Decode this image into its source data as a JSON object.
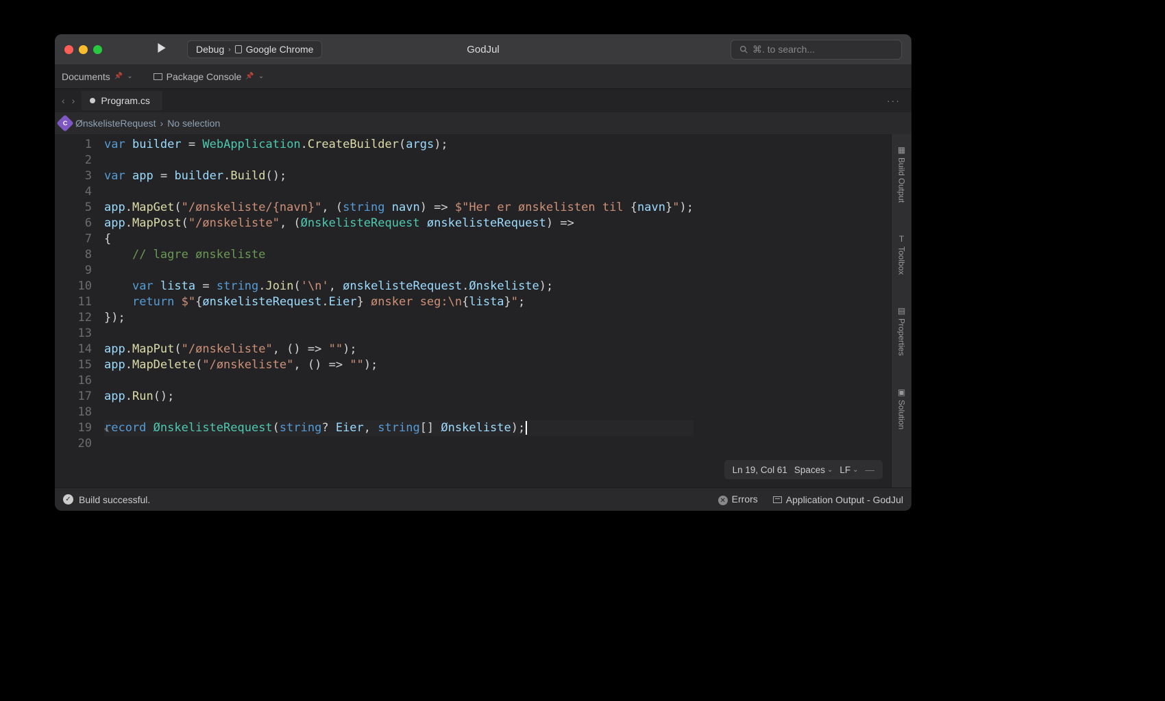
{
  "window": {
    "title": "GodJul"
  },
  "titlebar": {
    "debug_config": "Debug",
    "target": "Google Chrome",
    "search_placeholder": "⌘. to search..."
  },
  "toolrow": {
    "documents": "Documents",
    "package_console": "Package Console"
  },
  "tabs": {
    "active": "Program.cs"
  },
  "breadcrumb": {
    "item1": "ØnskelisteRequest",
    "item2": "No selection"
  },
  "side_panels": [
    "Build Output",
    "Toolbox",
    "Properties",
    "Solution"
  ],
  "cursor_status": {
    "position": "Ln 19, Col 61",
    "indent": "Spaces",
    "eol": "LF"
  },
  "statusbar": {
    "build_msg": "Build successful.",
    "errors_label": "Errors",
    "app_output_label": "Application Output - GodJul"
  },
  "code": {
    "line_count": 20,
    "tokens": [
      [
        [
          "kw",
          "var"
        ],
        [
          "",
          " "
        ],
        [
          "param",
          "builder"
        ],
        [
          "",
          " "
        ],
        [
          "op",
          "="
        ],
        [
          "",
          " "
        ],
        [
          "type",
          "WebApplication"
        ],
        [
          "",
          "."
        ],
        [
          "method",
          "CreateBuilder"
        ],
        [
          "",
          "("
        ],
        [
          "param",
          "args"
        ],
        [
          "",
          ");"
        ]
      ],
      [],
      [
        [
          "kw",
          "var"
        ],
        [
          "",
          " "
        ],
        [
          "param",
          "app"
        ],
        [
          "",
          " "
        ],
        [
          "op",
          "="
        ],
        [
          "",
          " "
        ],
        [
          "param",
          "builder"
        ],
        [
          "",
          "."
        ],
        [
          "method",
          "Build"
        ],
        [
          "",
          "();"
        ]
      ],
      [],
      [
        [
          "param",
          "app"
        ],
        [
          "",
          "."
        ],
        [
          "method",
          "MapGet"
        ],
        [
          "",
          "("
        ],
        [
          "str",
          "\"/ønskeliste/{navn}\""
        ],
        [
          "",
          ", ("
        ],
        [
          "kw",
          "string"
        ],
        [
          "",
          " "
        ],
        [
          "param",
          "navn"
        ],
        [
          "",
          ") "
        ],
        [
          "op",
          "=>"
        ],
        [
          "",
          " "
        ],
        [
          "str",
          "$\"Her er ønskelisten til "
        ],
        [
          "",
          "{"
        ],
        [
          "param",
          "navn"
        ],
        [
          "",
          "}"
        ],
        [
          "str",
          "\""
        ],
        [
          "",
          ");"
        ]
      ],
      [
        [
          "param",
          "app"
        ],
        [
          "",
          "."
        ],
        [
          "method",
          "MapPost"
        ],
        [
          "",
          "("
        ],
        [
          "str",
          "\"/ønskeliste\""
        ],
        [
          "",
          ", ("
        ],
        [
          "type",
          "ØnskelisteRequest"
        ],
        [
          "",
          " "
        ],
        [
          "param",
          "ønskelisteRequest"
        ],
        [
          "",
          ") "
        ],
        [
          "op",
          "=>"
        ]
      ],
      [
        [
          "",
          "{"
        ]
      ],
      [
        [
          "",
          "    "
        ],
        [
          "comment",
          "// lagre ønskeliste"
        ]
      ],
      [],
      [
        [
          "",
          "    "
        ],
        [
          "kw",
          "var"
        ],
        [
          "",
          " "
        ],
        [
          "param",
          "lista"
        ],
        [
          "",
          " "
        ],
        [
          "op",
          "="
        ],
        [
          "",
          " "
        ],
        [
          "kw",
          "string"
        ],
        [
          "",
          "."
        ],
        [
          "method",
          "Join"
        ],
        [
          "",
          "("
        ],
        [
          "str",
          "'\\n'"
        ],
        [
          "",
          ", "
        ],
        [
          "param",
          "ønskelisteRequest"
        ],
        [
          "",
          "."
        ],
        [
          "param",
          "Ønskeliste"
        ],
        [
          "",
          ");"
        ]
      ],
      [
        [
          "",
          "    "
        ],
        [
          "kw",
          "return"
        ],
        [
          "",
          " "
        ],
        [
          "str",
          "$\""
        ],
        [
          "",
          "{"
        ],
        [
          "param",
          "ønskelisteRequest"
        ],
        [
          "",
          "."
        ],
        [
          "param",
          "Eier"
        ],
        [
          "",
          "}"
        ],
        [
          "str",
          " ønsker seg:\\n"
        ],
        [
          "",
          "{"
        ],
        [
          "param",
          "lista"
        ],
        [
          "",
          "}"
        ],
        [
          "str",
          "\""
        ],
        [
          "",
          ";"
        ]
      ],
      [
        [
          "",
          "});"
        ]
      ],
      [],
      [
        [
          "param",
          "app"
        ],
        [
          "",
          "."
        ],
        [
          "method",
          "MapPut"
        ],
        [
          "",
          "("
        ],
        [
          "str",
          "\"/ønskeliste\""
        ],
        [
          "",
          ", () "
        ],
        [
          "op",
          "=>"
        ],
        [
          "",
          " "
        ],
        [
          "str",
          "\"\""
        ],
        [
          "",
          ");"
        ]
      ],
      [
        [
          "param",
          "app"
        ],
        [
          "",
          "."
        ],
        [
          "method",
          "MapDelete"
        ],
        [
          "",
          "("
        ],
        [
          "str",
          "\"/ønskeliste\""
        ],
        [
          "",
          ", () "
        ],
        [
          "op",
          "=>"
        ],
        [
          "",
          " "
        ],
        [
          "str",
          "\"\""
        ],
        [
          "",
          ");"
        ]
      ],
      [],
      [
        [
          "param",
          "app"
        ],
        [
          "",
          "."
        ],
        [
          "method",
          "Run"
        ],
        [
          "",
          "();"
        ]
      ],
      [],
      [
        [
          "kw",
          "record"
        ],
        [
          "",
          " "
        ],
        [
          "type",
          "ØnskelisteRequest"
        ],
        [
          "",
          "("
        ],
        [
          "kw",
          "string"
        ],
        [
          "",
          "? "
        ],
        [
          "param",
          "Eier"
        ],
        [
          "",
          ", "
        ],
        [
          "kw",
          "string"
        ],
        [
          "",
          "[] "
        ],
        [
          "param",
          "Ønskeliste"
        ],
        [
          "",
          ");"
        ]
      ],
      []
    ]
  }
}
